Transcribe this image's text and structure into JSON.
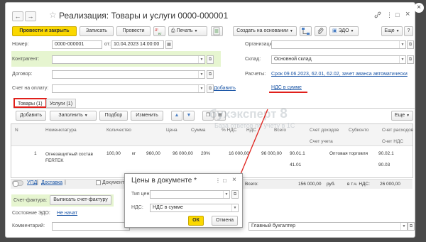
{
  "window": {
    "title": "Реализация: Товары и услуги 0000-000001",
    "nav_back": "←",
    "nav_forward": "→",
    "star": "☆",
    "link_icon": "🔗",
    "more_icon": "⋮",
    "restore_icon": "□",
    "close_icon": "×"
  },
  "toolbar": {
    "post_close": "Провести и закрыть",
    "save": "Записать",
    "post": "Провести",
    "print": "Печать",
    "create_based": "Создать на основании",
    "edo": "ЭДО",
    "more": "Еще",
    "help": "?"
  },
  "form": {
    "number_label": "Номер:",
    "number_value": "0000-000001",
    "date_label": "от:",
    "date_value": "10.04.2023 14:00:00",
    "org_label": "Организация:",
    "org_value": "",
    "contractor_label": "Контрагент:",
    "contractor_value": "",
    "warehouse_label": "Склад:",
    "warehouse_value": "Основной склад",
    "contract_label": "Договор:",
    "contract_value": "",
    "settlements_label": "Расчеты:",
    "settlements_link": "Срок 09.06.2023, 62.01, 62.02, зачет аванса автоматически",
    "invoice_label": "Счет на оплату:",
    "invoice_value": "",
    "add_link": "Добавить",
    "vat_link": "НДС в сумме"
  },
  "tabs": [
    {
      "label": "Товары (1)"
    },
    {
      "label": "Услуги (1)"
    }
  ],
  "table_toolbar": {
    "add": "Добавить",
    "fill": "Заполнить",
    "select": "Подбор",
    "change": "Изменить",
    "more": "Еще"
  },
  "table": {
    "headers": {
      "n": "N",
      "nomenclature": "Номенклатура",
      "qty": "Количество",
      "price": "Цена",
      "sum": "Сумма",
      "vat_pct": "% НДС",
      "vat": "НДС",
      "total": "Всего",
      "income_acc": "Счет доходов",
      "acc_acc": "Счет учета",
      "subconto": "Субконто",
      "expense_acc": "Счет расходов",
      "vat_acc": "Счет НДС"
    },
    "row": {
      "n": "1",
      "nomenclature": "Огнезащитный состав FERTEK",
      "qty": "100,00",
      "unit": "кг",
      "price": "960,00",
      "sum": "96 000,00",
      "vat_pct": "20%",
      "vat": "16 000,00",
      "total": "96 000,00",
      "income_acc": "90.01.1",
      "acc_acc": "41.01",
      "subconto": "Оптовая торговля",
      "expense_acc": "90.02.1",
      "vat_acc": "90.03"
    }
  },
  "totals": {
    "total_label": "Всего:",
    "total_value": "156 000,00",
    "currency": "руб.",
    "vat_label": "в т.ч. НДС:",
    "vat_value": "26 000,00"
  },
  "bottom": {
    "upd_link": "УПД",
    "delivery_link": "Доставка",
    "document_label": "Документ",
    "invoice_label": "Счет-фактура:",
    "invoice_btn": "Выписать счет-фактуру",
    "edo_status_label": "Состояние ЭДО:",
    "edo_status_link": "Не начат",
    "comment_label": "Комментарий:",
    "accountant_label": "Главный бухгалтер"
  },
  "watermark": {
    "main": "бухэксперт",
    "digit": "8",
    "sub": "База ответов по учету в 1С"
  },
  "dialog": {
    "title": "Цены в документе *",
    "price_type_label": "Тип цен:",
    "price_type_value": "",
    "vat_label": "НДС:",
    "vat_value": "НДС в сумме",
    "ok": "ОК",
    "cancel": "Отмена"
  },
  "accent": "#e0201b"
}
